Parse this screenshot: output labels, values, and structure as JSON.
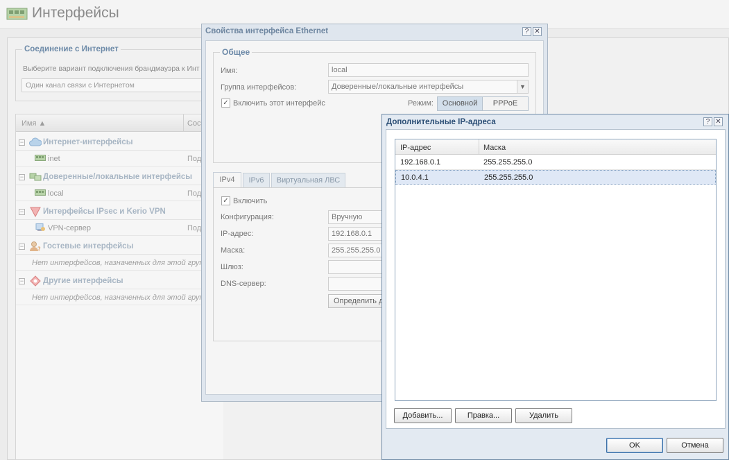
{
  "page": {
    "title": "Интерфейсы"
  },
  "connection": {
    "legend": "Соединение с Интернет",
    "description": "Выберите вариант подключения брандмауэра к Инт",
    "mode_value": "Один канал связи с Интернетом"
  },
  "grid": {
    "col_name": "Имя ▲",
    "col_state": "Сост",
    "groups": [
      {
        "label": "Интернет-интерфейсы",
        "items": [
          {
            "name": "inet",
            "state": "Под"
          }
        ]
      },
      {
        "label": "Доверенные/локальные интерфейсы",
        "items": [
          {
            "name": "local",
            "state": "Под"
          }
        ]
      },
      {
        "label": "Интерфейсы IPsec и Kerio VPN",
        "items": [
          {
            "name": "VPN-сервер",
            "state": "Под"
          }
        ]
      },
      {
        "label": "Гостевые интерфейсы",
        "empty": "Нет интерфейсов, назначенных для этой группы"
      },
      {
        "label": "Другие интерфейсы",
        "empty": "Нет интерфейсов, назначенных для этой группы"
      }
    ]
  },
  "eth_dialog": {
    "title": "Свойства интерфейса Ethernet",
    "help_glyph": "?",
    "close_glyph": "✕",
    "general_legend": "Общее",
    "name_label": "Имя:",
    "name_value": "local",
    "group_label": "Группа интерфейсов:",
    "group_value": "Доверенные/локальные интерфейсы",
    "enable_label": "Включить этот интерфейс",
    "mode_label": "Режим:",
    "mode_primary": "Основной",
    "mode_pppoe": "PPPoE",
    "tabs": [
      "IPv4",
      "IPv6",
      "Виртуальная ЛВС"
    ],
    "ipv4": {
      "enable_label": "Включить",
      "config_label": "Конфигурация:",
      "config_value": "Вручную",
      "ip_label": "IP-адрес:",
      "ip_value": "192.168.0.1",
      "mask_label": "Маска:",
      "mask_value": "255.255.255.0",
      "gateway_label": "Шлюз:",
      "dns_label": "DNS-сервер:",
      "detect_button": "Определить д"
    }
  },
  "ip_dialog": {
    "title": "Дополнительные IP-адреса",
    "help_glyph": "?",
    "close_glyph": "✕",
    "col_ip": "IP-адрес",
    "col_mask": "Маска",
    "rows": [
      {
        "ip": "192.168.0.1",
        "mask": "255.255.255.0"
      },
      {
        "ip": "10.0.4.1",
        "mask": "255.255.255.0"
      }
    ],
    "add_button": "Добавить...",
    "edit_button": "Правка...",
    "delete_button": "Удалить",
    "ok_button": "OK",
    "cancel_button": "Отмена"
  },
  "colors": {
    "legend_blue": "#6d8aa8",
    "dialog_title_blue": "#2b4e75",
    "selection": "#dfe8f6"
  }
}
